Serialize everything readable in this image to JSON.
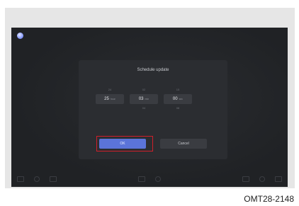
{
  "dialog": {
    "title": "Schedule update",
    "hour": {
      "prev": "24",
      "current": "25",
      "unit": "hour",
      "next": ""
    },
    "minute": {
      "prev": "02",
      "current": "03",
      "unit": "min",
      "next": "04"
    },
    "second": {
      "prev": "15",
      "current": "00",
      "unit": "sec",
      "next": "08"
    },
    "ok_label": "OK",
    "cancel_label": "Cancel"
  },
  "figure_code": "OMT28-2148",
  "colors": {
    "accent": "#5b74d9",
    "highlight": "#d11f2a",
    "screen_bg": "#202225"
  },
  "icons": {
    "home": "home-icon"
  }
}
